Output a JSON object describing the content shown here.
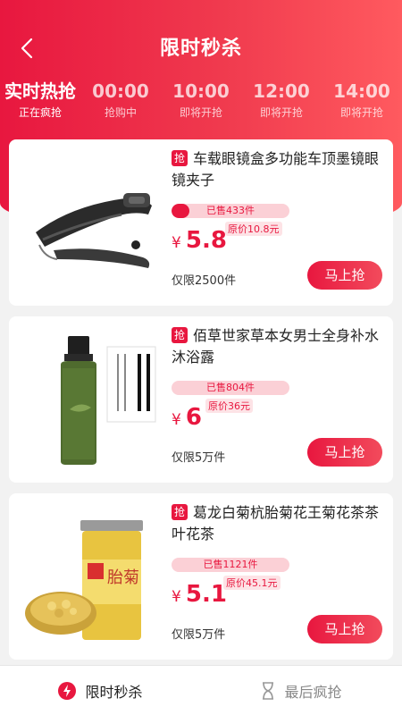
{
  "header": {
    "title": "限时秒杀",
    "back_label": "返回"
  },
  "sessions": [
    {
      "time": "实时热抢",
      "status": "正在疯抢",
      "active": true
    },
    {
      "time": "00:00",
      "status": "抢购中"
    },
    {
      "time": "10:00",
      "status": "即将开抢"
    },
    {
      "time": "12:00",
      "status": "即将开抢"
    },
    {
      "time": "14:00",
      "status": "即将开抢"
    }
  ],
  "products": [
    {
      "tag": "抢",
      "name": "车载眼镜盒多功能车顶墨镜眼镜夹子",
      "sold": "已售433件",
      "sold_progress": 0.15,
      "currency": "¥",
      "price": "5.8",
      "original": "原价10.8元",
      "limit": "仅限2500件",
      "buy": "马上抢",
      "image": "glasses-clip"
    },
    {
      "tag": "抢",
      "name": "佰草世家草本女男士全身补水沐浴露",
      "sold": "已售804件",
      "sold_progress": 0.0,
      "currency": "¥",
      "price": "6",
      "original": "原价36元",
      "limit": "仅限5万件",
      "buy": "马上抢",
      "image": "body-wash-bottle"
    },
    {
      "tag": "抢",
      "name": "葛龙白菊杭胎菊花王菊花茶茶叶花茶",
      "sold": "已售1121件",
      "sold_progress": 0.0,
      "currency": "¥",
      "price": "5.1",
      "original": "原价45.1元",
      "limit": "仅限5万件",
      "buy": "马上抢",
      "image": "chrysanthemum-tea-jar"
    }
  ],
  "tabbar": [
    {
      "label": "限时秒杀",
      "icon": "lightning-icon",
      "active": true
    },
    {
      "label": "最后疯抢",
      "icon": "hourglass-icon"
    }
  ],
  "colors": {
    "accent": "#e8173f",
    "accent_light": "#fbd0d6"
  }
}
